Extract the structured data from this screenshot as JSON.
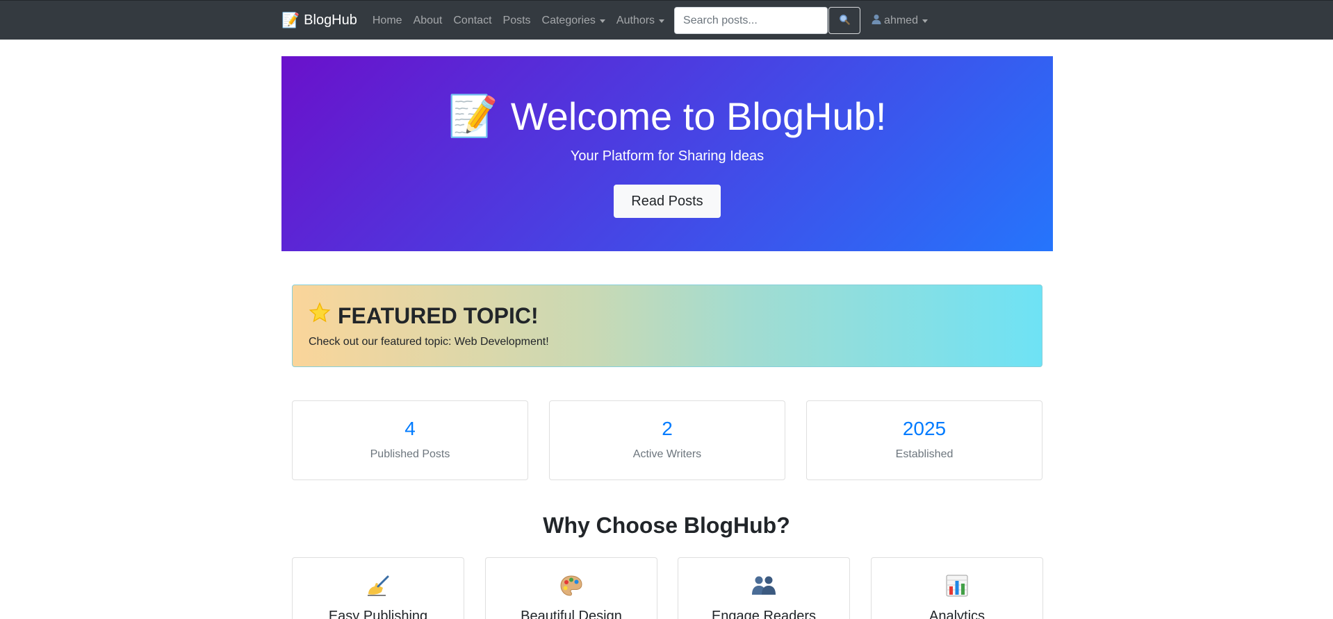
{
  "navbar": {
    "brand": "BlogHub",
    "brand_icon": "memo-icon",
    "links": [
      {
        "label": "Home"
      },
      {
        "label": "About"
      },
      {
        "label": "Contact"
      },
      {
        "label": "Posts"
      },
      {
        "label": "Categories",
        "dropdown": true
      },
      {
        "label": "Authors",
        "dropdown": true
      }
    ],
    "search": {
      "placeholder": "Search posts...",
      "value": "",
      "button_icon": "search-icon"
    },
    "user": {
      "label": "ahmed",
      "icon": "user-icon",
      "dropdown": true
    }
  },
  "hero": {
    "title": "Welcome to BlogHub!",
    "title_icon": "memo-icon",
    "subtitle": "Your Platform for Sharing Ideas",
    "button_label": "Read Posts",
    "gradient_start": "#6a11cb",
    "gradient_end": "#2575fc"
  },
  "featured": {
    "title": "FEATURED TOPIC!",
    "title_icon": "star-icon",
    "text": "Check out our featured topic: Web Development!"
  },
  "stats": [
    {
      "value": "4",
      "label": "Published Posts"
    },
    {
      "value": "2",
      "label": "Active Writers"
    },
    {
      "value": "2025",
      "label": "Established"
    }
  ],
  "why": {
    "title": "Why Choose BlogHub?",
    "features": [
      {
        "title": "Easy Publishing",
        "icon": "writing-hand-icon"
      },
      {
        "title": "Beautiful Design",
        "icon": "palette-icon"
      },
      {
        "title": "Engage Readers",
        "icon": "people-icon"
      },
      {
        "title": "Analytics",
        "icon": "bar-chart-icon"
      }
    ]
  },
  "colors": {
    "navbar_bg": "#343a40",
    "accent": "#007bff",
    "muted": "#6c757d"
  }
}
